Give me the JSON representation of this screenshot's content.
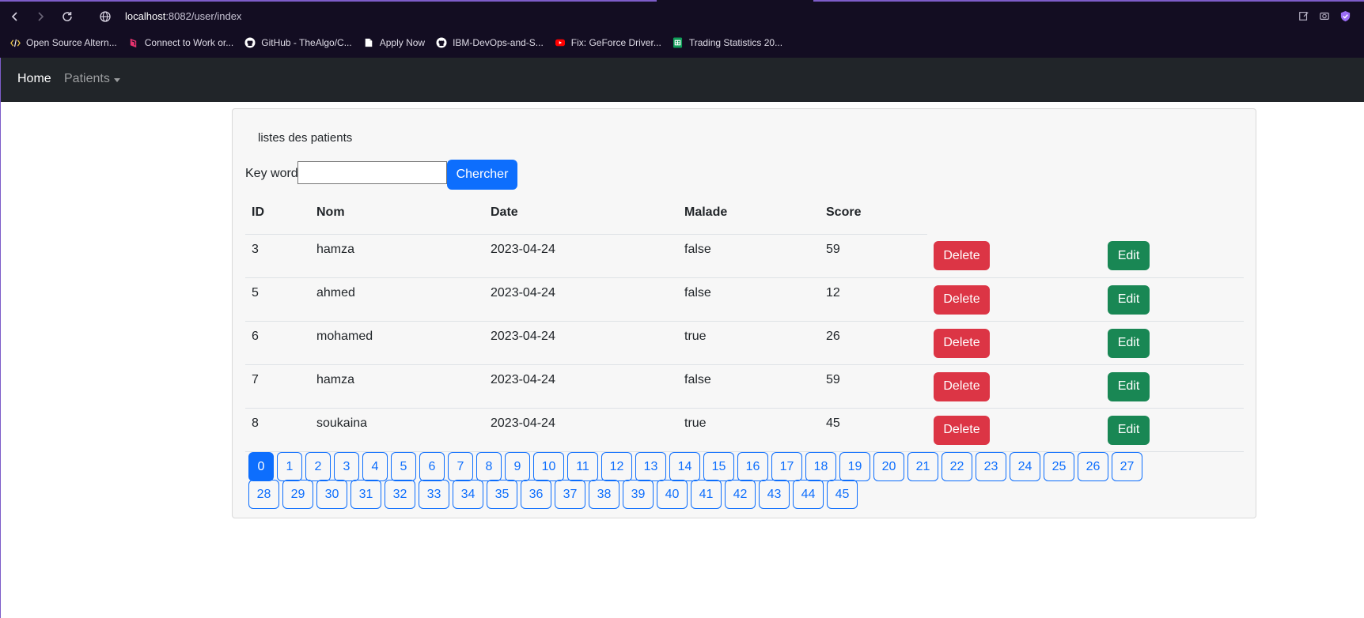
{
  "browser": {
    "url_host": "localhost",
    "url_path": ":8082/user/index",
    "bookmarks": [
      {
        "label": "Open Source Altern...",
        "icon": "code-icon",
        "color": "#e8c547"
      },
      {
        "label": "Connect to Work or...",
        "icon": "connect-icon",
        "color": "#e8336f"
      },
      {
        "label": "GitHub - TheAlgo/C...",
        "icon": "github-icon",
        "color": "#ffffff"
      },
      {
        "label": "Apply Now",
        "icon": "file-icon",
        "color": "#ffffff"
      },
      {
        "label": "IBM-DevOps-and-S...",
        "icon": "github-icon",
        "color": "#ffffff"
      },
      {
        "label": "Fix: GeForce Driver...",
        "icon": "youtube-icon",
        "color": "#ff0000"
      },
      {
        "label": "Trading Statistics 20...",
        "icon": "sheets-icon",
        "color": "#0f9d58"
      }
    ]
  },
  "navbar": {
    "home": "Home",
    "patients": "Patients"
  },
  "card": {
    "title": "listes des patients",
    "search_label": "Key word",
    "search_value": "",
    "search_button": "Chercher"
  },
  "table": {
    "headers": [
      "ID",
      "Nom",
      "Date",
      "Malade",
      "Score"
    ],
    "delete_label": "Delete",
    "edit_label": "Edit",
    "rows": [
      {
        "id": "3",
        "nom": "hamza",
        "date": "2023-04-24",
        "malade": "false",
        "score": "59"
      },
      {
        "id": "5",
        "nom": "ahmed",
        "date": "2023-04-24",
        "malade": "false",
        "score": "12"
      },
      {
        "id": "6",
        "nom": "mohamed",
        "date": "2023-04-24",
        "malade": "true",
        "score": "26"
      },
      {
        "id": "7",
        "nom": "hamza",
        "date": "2023-04-24",
        "malade": "false",
        "score": "59"
      },
      {
        "id": "8",
        "nom": "soukaina",
        "date": "2023-04-24",
        "malade": "true",
        "score": "45"
      }
    ]
  },
  "pagination": {
    "current": "0",
    "pages": [
      "0",
      "1",
      "2",
      "3",
      "4",
      "5",
      "6",
      "7",
      "8",
      "9",
      "10",
      "11",
      "12",
      "13",
      "14",
      "15",
      "16",
      "17",
      "18",
      "19",
      "20",
      "21",
      "22",
      "23",
      "24",
      "25",
      "26",
      "27",
      "28",
      "29",
      "30",
      "31",
      "32",
      "33",
      "34",
      "35",
      "36",
      "37",
      "38",
      "39",
      "40",
      "41",
      "42",
      "43",
      "44",
      "45"
    ]
  },
  "colors": {
    "primary": "#0d6efd",
    "danger": "#dc3545",
    "success": "#198754",
    "navbar": "#212529",
    "chrome": "#130d22"
  }
}
